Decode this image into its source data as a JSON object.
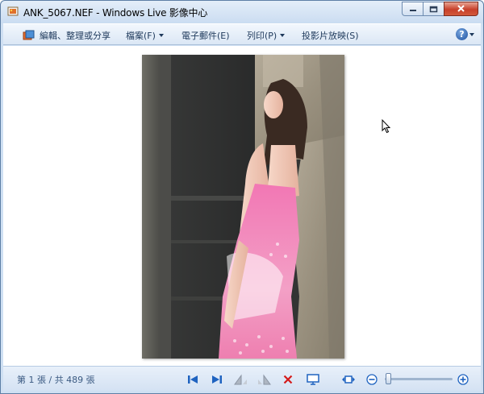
{
  "window": {
    "title": "ANK_5067.NEF - Windows Live 影像中心"
  },
  "menubar": {
    "items": [
      {
        "label": "編輯、整理或分享",
        "has_dropdown": false
      },
      {
        "label": "檔案(F)",
        "has_dropdown": true
      },
      {
        "label": "電子郵件(E)",
        "has_dropdown": false
      },
      {
        "label": "列印(P)",
        "has_dropdown": true
      },
      {
        "label": "投影片放映(S)",
        "has_dropdown": false
      }
    ],
    "help_label": "?"
  },
  "status": {
    "page_count": "第 1 張 / 共 489 張"
  },
  "toolbar_icons": [
    "previous-icon",
    "next-icon",
    "rotate-left-icon",
    "rotate-right-icon",
    "delete-icon",
    "slideshow-icon",
    "actual-size-icon",
    "zoom-out-icon",
    "zoom-in-icon"
  ],
  "colors": {
    "accent": "#1c4f9e",
    "delete": "#d41a1a",
    "frame": "#cfe0f3"
  },
  "zoom": {
    "level": 0.05
  }
}
